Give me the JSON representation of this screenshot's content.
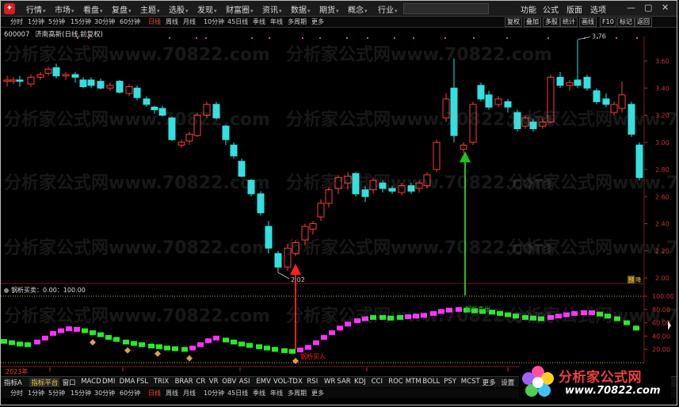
{
  "menu": {
    "items_left": [
      "行情",
      "市场",
      "看盘",
      "复盘",
      "主题",
      "选股",
      "发现",
      "财富圈",
      "资讯",
      "数据",
      "期货",
      "概念",
      "行业"
    ],
    "items_right": [
      "功能",
      "公式",
      "版面",
      "选项"
    ],
    "window_controls": [
      "—",
      "▢",
      "✕"
    ]
  },
  "timeframes": [
    "分时",
    "1分钟",
    "5分钟",
    "15分钟",
    "30分钟",
    "60分钟",
    "日线",
    "周线",
    "月线",
    "10分钟",
    "45日线",
    "季线",
    "年线",
    "多周期",
    "更多"
  ],
  "timeframe_active": "日线",
  "right_buttons": [
    "复权",
    "叠加",
    "多股",
    "统计",
    "画线",
    "F10",
    "标记",
    "返回"
  ],
  "stock": {
    "code": "600007",
    "name": "济南高新(日线,前复权)"
  },
  "price_axis": [
    "3.60",
    "3.40",
    "3.20",
    "3.00",
    "2.80",
    "2.60",
    "2.40",
    "2.20",
    "2.00"
  ],
  "annotations": {
    "high": "3.76",
    "low": "2.02",
    "buy_label": "钢析买入",
    "sell_label": "钢析卖出",
    "side_tags": [
      "预",
      "降"
    ]
  },
  "indicator": {
    "title": "钢析买卖：0.00：100.00",
    "axis": [
      "100.00",
      "80.00",
      "60.00",
      "40.00",
      "20.00"
    ]
  },
  "year_label": "2023年",
  "indicator_tabs": [
    "指标A",
    "指标平台",
    "窗口",
    "MACD",
    "DMI",
    "DMA",
    "FSL",
    "TRIX",
    "BRAR",
    "CR",
    "VR",
    "OBV",
    "ASI",
    "EMV",
    "VOL-TDX",
    "RSI",
    "WR",
    "SAR",
    "KDJ",
    "CCI",
    "ROC",
    "MTM",
    "BOLL",
    "PSY",
    "MCST",
    "更多",
    "设置"
  ],
  "indicator_tab_active": "指标平台",
  "bottom_tabs": [
    "分时",
    "1分钟",
    "5分钟",
    "15分钟",
    "30分钟",
    "60分钟",
    "日线",
    "周线",
    "月线",
    "10分钟",
    "45日线",
    "季线",
    "年线",
    "多周期",
    "更多"
  ],
  "watermark": [
    "分析家公式网www.70822.com"
  ],
  "brand": {
    "title": "分析家公式网",
    "url": "www.70822.com"
  },
  "colors": {
    "up": "#ff3a3a",
    "down": "#33e0e0",
    "buy_arrow": "#ff2020",
    "sell_arrow": "#22c022",
    "ind_up": "#ff30ff",
    "ind_down": "#22ee22",
    "marker": "#e0a040"
  }
}
